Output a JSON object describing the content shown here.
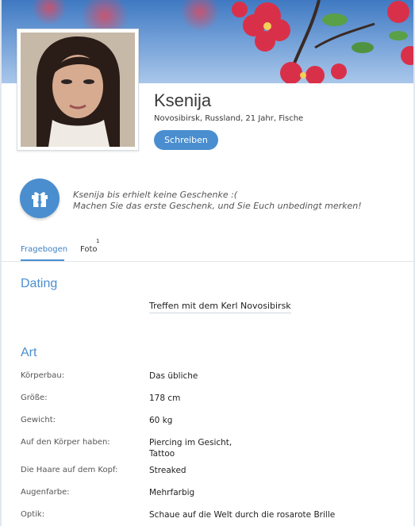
{
  "profile": {
    "name": "Ksenija",
    "meta": "Novosibirsk, Russland, 21 Jahr, Fische",
    "write_button": "Schreiben"
  },
  "gifts": {
    "line1": "Ksenija bis erhielt keine Geschenke :(",
    "line2": "Machen Sie das erste Geschenk, und Sie Euch unbedingt merken!"
  },
  "tabs": {
    "questionnaire": "Fragebogen",
    "photo": "Foto",
    "photo_count": "1"
  },
  "dating": {
    "title": "Dating",
    "value": "Treffen mit dem Kerl Novosibirsk"
  },
  "art": {
    "title": "Art",
    "rows": [
      {
        "label": "Körperbau:",
        "value": "Das übliche"
      },
      {
        "label": "Größe:",
        "value": "178 cm"
      },
      {
        "label": "Gewicht:",
        "value": "60 kg"
      },
      {
        "label": "Auf den Körper haben:",
        "value": "Piercing im Gesicht,",
        "value2": "Tattoo"
      },
      {
        "label": "Die Haare auf dem Kopf:",
        "value": "Streaked"
      },
      {
        "label": "Augenfarbe:",
        "value": "Mehrfarbig"
      },
      {
        "label": "Optik:",
        "value": "Schaue auf die Welt durch die rosarote Brille"
      }
    ]
  },
  "colors": {
    "accent": "#4a8ecf",
    "cover_sky": "#3f79c2",
    "flower": "#d9304a"
  }
}
